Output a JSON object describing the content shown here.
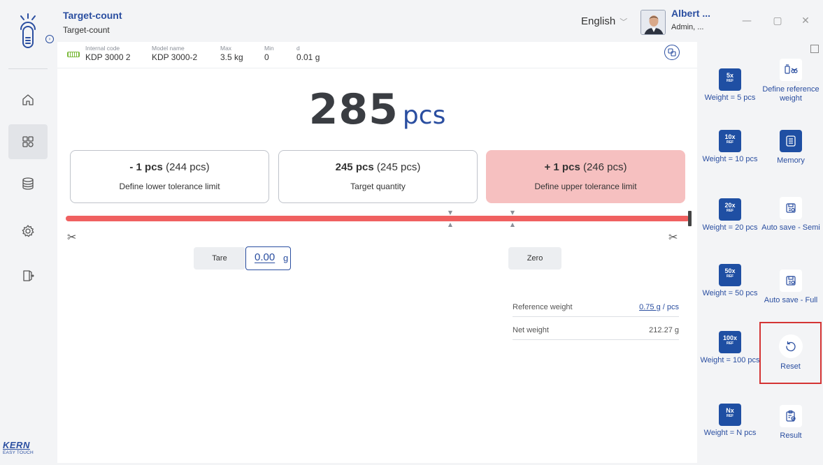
{
  "header": {
    "title": "Target-count",
    "subtitle": "Target-count",
    "language": "English",
    "user_name": "Albert ...",
    "user_role": "Admin, ..."
  },
  "info": [
    {
      "label": "Internal code",
      "value": "KDP 3000 2"
    },
    {
      "label": "Model name",
      "value": "KDP 3000-2"
    },
    {
      "label": "Max",
      "value": "3.5 kg"
    },
    {
      "label": "Min",
      "value": "0"
    },
    {
      "label": "d",
      "value": "0.01 g"
    }
  ],
  "display": {
    "value": "285",
    "unit": "pcs"
  },
  "tolerance": {
    "lower": {
      "delta": "- 1 pcs",
      "qty": "(244 pcs)",
      "label": "Define lower tolerance limit"
    },
    "target": {
      "delta": "245 pcs",
      "qty": "(245 pcs)",
      "label": "Target quantity"
    },
    "upper": {
      "delta": "+ 1 pcs",
      "qty": "(246 pcs)",
      "label": "Define upper tolerance limit"
    }
  },
  "tare": {
    "label": "Tare",
    "value": "0.00",
    "unit": "g"
  },
  "zero": {
    "label": "Zero"
  },
  "reference_weight": {
    "label": "Reference weight",
    "value": "0.75 g",
    "unit": "/ pcs"
  },
  "net_weight": {
    "label": "Net weight",
    "value": "212.27 g"
  },
  "ref_buttons": [
    {
      "num": "5x",
      "tag": "REF",
      "label": "Weight = 5 pcs"
    },
    {
      "num": "10x",
      "tag": "REF",
      "label": "Weight = 10 pcs"
    },
    {
      "num": "20x",
      "tag": "REF",
      "label": "Weight = 20 pcs"
    },
    {
      "num": "50x",
      "tag": "REF",
      "label": "Weight = 50 pcs"
    },
    {
      "num": "100x",
      "tag": "REF",
      "label": "Weight = 100 pcs"
    },
    {
      "num": "Nx",
      "tag": "REF",
      "label": "Weight = N pcs"
    }
  ],
  "fn_buttons": [
    {
      "label": "Define reference weight"
    },
    {
      "label": "Memory"
    },
    {
      "label": "Auto save - Semi"
    },
    {
      "label": "Auto save - Full"
    },
    {
      "label": "Reset"
    },
    {
      "label": "Result"
    }
  ],
  "brand": {
    "name": "KERN",
    "sub": "EASY TOUCH"
  },
  "colors": {
    "accent": "#2a4ea0",
    "button_blue": "#1f4fa3",
    "alert_bg": "#f6c0c0",
    "bar_red": "#f06060",
    "highlight_red": "#d43434"
  }
}
